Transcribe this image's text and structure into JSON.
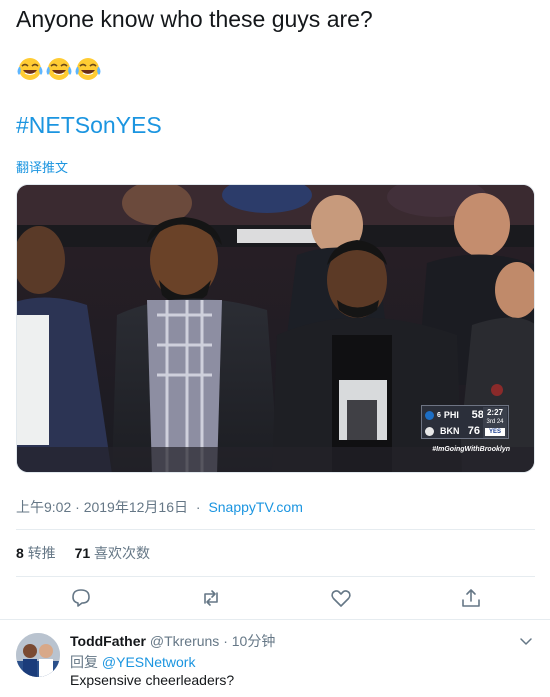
{
  "tweet": {
    "text": "Anyone know who these guys are?",
    "emoji": [
      "face-with-tears-of-joy",
      "face-with-tears-of-joy",
      "face-with-tears-of-joy"
    ],
    "hashtag": "#NETSonYES",
    "translate_label": "翻译推文",
    "timestamp": "上午9:02 · 2019年12月16日",
    "source": "SnappyTV.com",
    "retweets_count": "8",
    "retweets_label": "转推",
    "likes_count": "71",
    "likes_label": "喜欢次数"
  },
  "media": {
    "description_icon": "video-still",
    "scorebug": {
      "team1": {
        "seed": "6",
        "abbr": "PHI",
        "score": "58"
      },
      "team2": {
        "seed": "",
        "abbr": "BKN",
        "score": "76"
      },
      "clock": "2:27",
      "quarter": "3rd",
      "shot_clock": "24",
      "network": "YES",
      "tagline": "#ImGoingWithBrooklyn"
    }
  },
  "actions": [
    "reply-icon",
    "retweet-icon",
    "like-icon",
    "share-icon"
  ],
  "reply": {
    "name": "ToddFather",
    "handle": "@Tkreruns",
    "time": "· 10分钟",
    "replying_label": "回复",
    "replying_to": "@YESNetwork",
    "text": "Expsensive cheerleaders?"
  },
  "colors": {
    "link": "#1b95e0",
    "muted": "#657786",
    "text": "#14171a",
    "divider": "#e6ecf0"
  }
}
